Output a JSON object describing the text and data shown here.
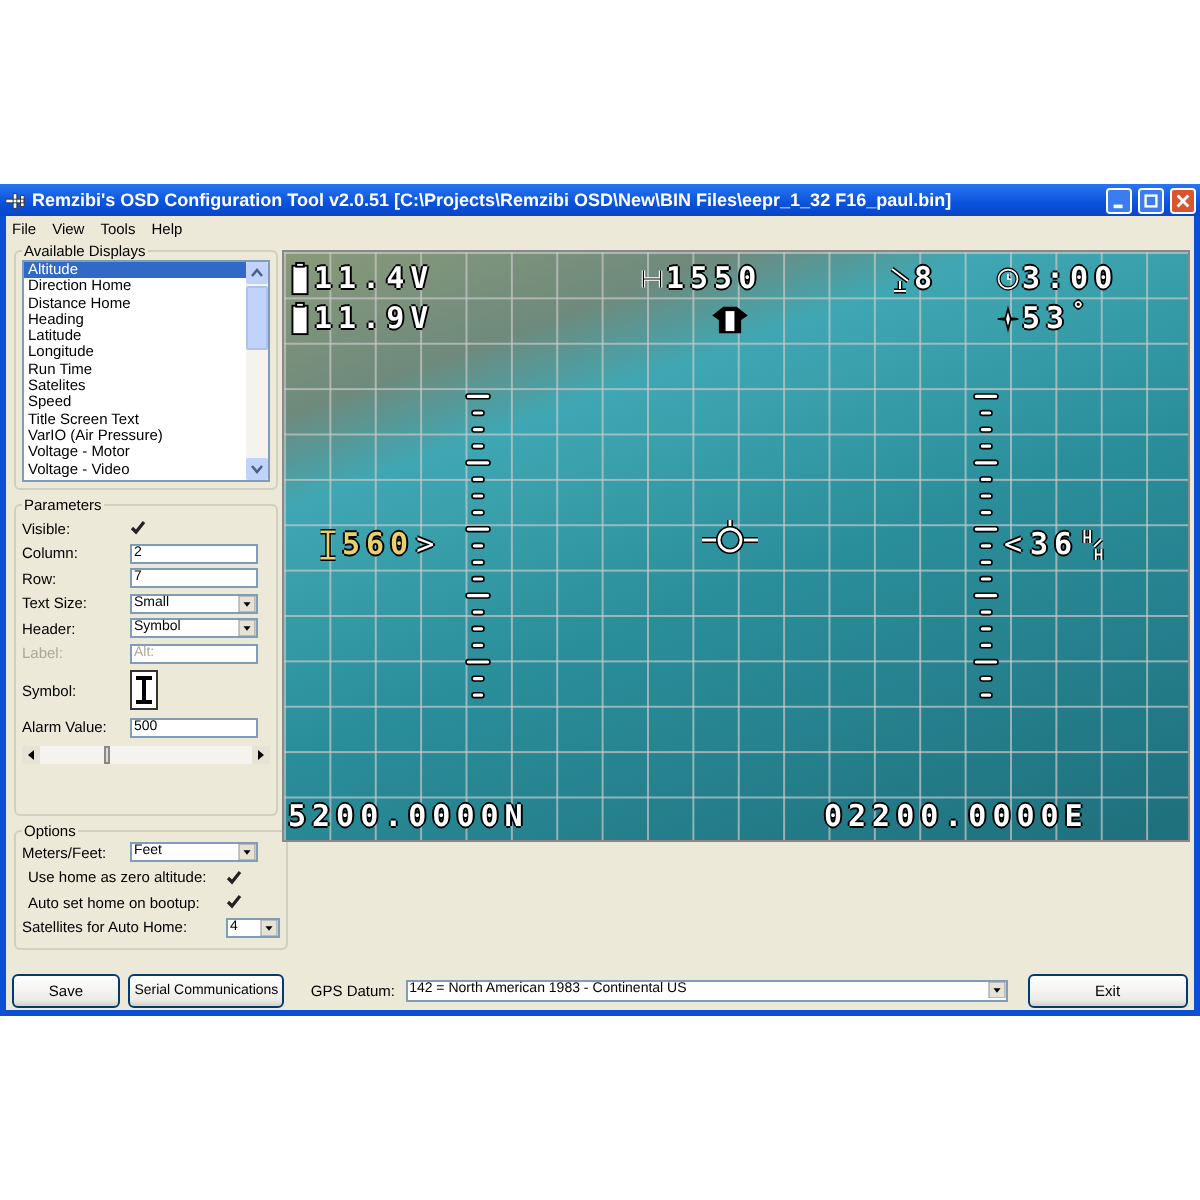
{
  "window": {
    "title": "Remzibi's OSD Configuration Tool v2.0.51 [C:\\Projects\\Remzibi OSD\\New\\BIN Files\\eepr_1_32 F16_paul.bin]"
  },
  "menu": [
    "File",
    "View",
    "Tools",
    "Help"
  ],
  "available_displays": {
    "title": "Available Displays",
    "items": [
      {
        "label": "Altitude",
        "selected": true
      },
      {
        "label": "Direction Home",
        "selected": false
      },
      {
        "label": "Distance Home",
        "selected": false
      },
      {
        "label": "Heading",
        "selected": false
      },
      {
        "label": "Latitude",
        "selected": false
      },
      {
        "label": "Longitude",
        "selected": false
      },
      {
        "label": "Run Time",
        "selected": false
      },
      {
        "label": "Satelites",
        "selected": false
      },
      {
        "label": "Speed",
        "selected": false
      },
      {
        "label": "Title Screen Text",
        "selected": false
      },
      {
        "label": "VarIO (Air Pressure)",
        "selected": false
      },
      {
        "label": "Voltage - Motor",
        "selected": false
      },
      {
        "label": "Voltage - Video",
        "selected": false
      }
    ]
  },
  "parameters": {
    "title": "Parameters",
    "visible": {
      "label": "Visible:",
      "checked": true
    },
    "fields": [
      {
        "kind": "text",
        "label": "Column:",
        "value": "2",
        "disabled": false
      },
      {
        "kind": "text",
        "label": "Row:",
        "value": "7",
        "disabled": false
      },
      {
        "kind": "select",
        "label": "Text Size:",
        "value": "Small",
        "disabled": false
      },
      {
        "kind": "select",
        "label": "Header:",
        "value": "Symbol",
        "disabled": false
      },
      {
        "kind": "text",
        "label": "Label:",
        "value": "Alt:",
        "disabled": true
      }
    ],
    "symbol_label": "Symbol:",
    "alarm": {
      "label": "Alarm Value:",
      "value": "500"
    },
    "slider": {
      "level": 0.32
    }
  },
  "options": {
    "title": "Options",
    "fields": [
      {
        "kind": "select",
        "label": "Meters/Feet:",
        "value": "Feet"
      },
      {
        "kind": "checkbox",
        "label": "Use home as zero altitude:",
        "checked": true
      },
      {
        "kind": "checkbox",
        "label": "Auto set home on bootup:",
        "checked": true
      },
      {
        "kind": "smallselect",
        "label": "Satellites for Auto Home:",
        "value": "4"
      }
    ]
  },
  "osd": {
    "main_battery": "11.4V",
    "video_battery": "11.9V",
    "distance": "1550",
    "satellites": "8",
    "timer": "3:00",
    "heading": "53",
    "heading_unit": "°",
    "altitude": "560",
    "altitude_arrow": ">",
    "speed_arrow": "<",
    "speed": "36",
    "latitude": "5200.0000N",
    "longitude": "02200.0000E"
  },
  "buttons": {
    "save": "Save",
    "serial": "Serial Communications",
    "exit": "Exit"
  },
  "gps_datum": {
    "label": "GPS Datum:",
    "value": "142 = North American 1983 - Continental US"
  }
}
